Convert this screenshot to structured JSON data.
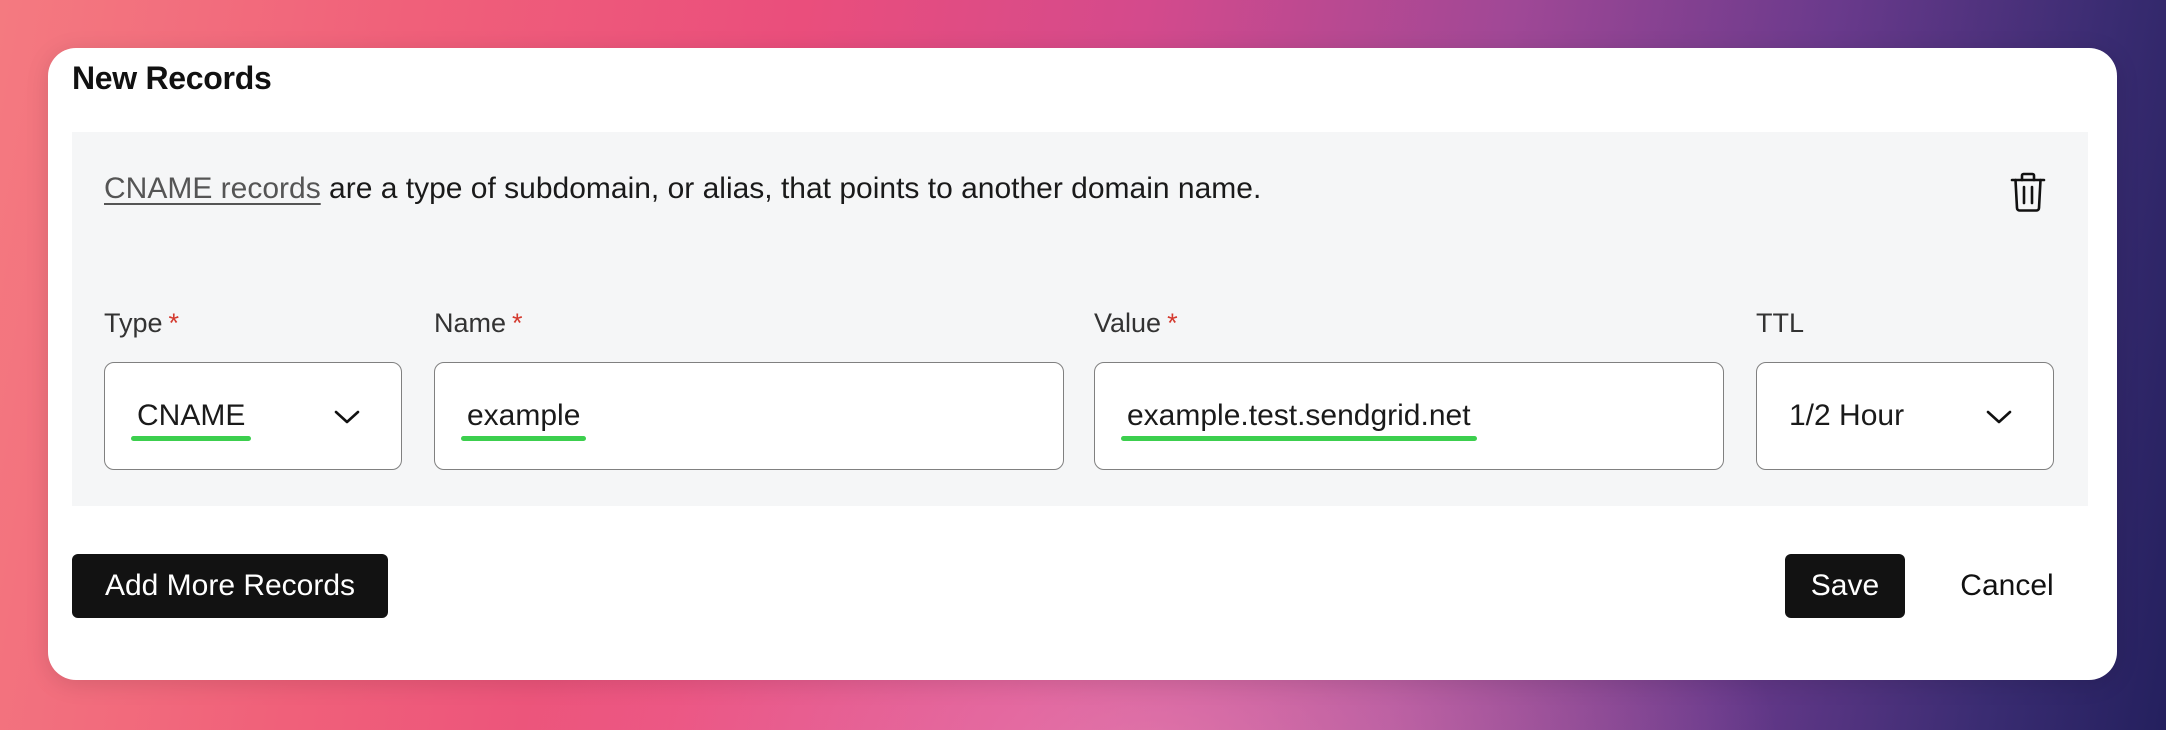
{
  "dialog": {
    "title": "New Records"
  },
  "record": {
    "description_link": "CNAME records",
    "description_rest": " are a type of subdomain, or alias, that points to another domain name.",
    "delete_icon": "trash-icon",
    "fields": {
      "type": {
        "label": "Type",
        "required_mark": "*",
        "value": "CNAME",
        "icon": "chevron-down-icon"
      },
      "name": {
        "label": "Name",
        "required_mark": "*",
        "value": "example"
      },
      "value": {
        "label": "Value",
        "required_mark": "*",
        "value": "example.test.sendgrid.net"
      },
      "ttl": {
        "label": "TTL",
        "value": "1/2 Hour",
        "icon": "chevron-down-icon"
      }
    }
  },
  "actions": {
    "add_more_label": "Add More Records",
    "save_label": "Save",
    "cancel_label": "Cancel"
  },
  "colors": {
    "highlight_underline": "#3ccf4e",
    "required_asterisk": "#d43a2f",
    "primary_button": "#121212"
  }
}
